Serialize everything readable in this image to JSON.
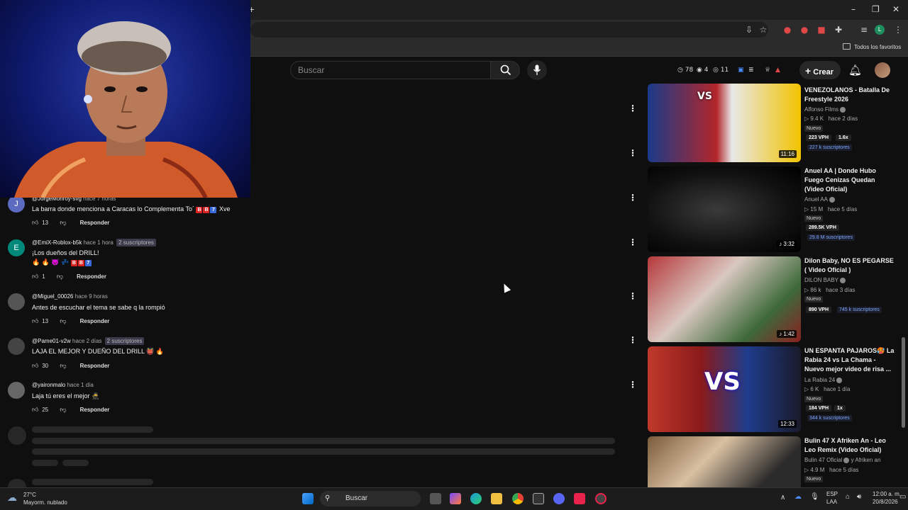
{
  "browser": {
    "new_tab_label": "+",
    "bookmarks_label": "Todos los favoritos",
    "window_controls": [
      "–",
      "❐",
      "✕"
    ]
  },
  "youtube": {
    "search_placeholder": "Buscar",
    "stats": {
      "views": "78",
      "eye": "4",
      "watch": "11"
    },
    "create_label": "Crear",
    "icons": [
      "search-icon",
      "mic-icon",
      "bell-icon",
      "plus-icon"
    ]
  },
  "comments": [
    {
      "author": "@JorgeMonroy-svg",
      "time": "hace 7 horas",
      "badge": "",
      "text": "La barra donde menciona a Caracas lo Complementa To´",
      "text_suffix": "Xve",
      "likes": "13",
      "reply": "Responder",
      "avatar_letter": "J",
      "avatar_color": "#5c6bc0"
    },
    {
      "author": "@EmiX-Roblox-b5k",
      "time": "hace 1 hora",
      "badge": "2 suscriptores",
      "text": "¡Los dueños del DRILL!",
      "text2": "🔥 🔥 😈 💤",
      "likes": "1",
      "reply": "Responder",
      "avatar_letter": "E",
      "avatar_color": "#00897b"
    },
    {
      "author": "@Miguel_00026",
      "time": "hace 9 horas",
      "badge": "",
      "text": "Antes de escuchar el tema se sabe q la rompió",
      "likes": "13",
      "reply": "Responder",
      "avatar_letter": "",
      "avatar_color": "#555"
    },
    {
      "author": "@Pame01-v2w",
      "time": "hace 2 días",
      "badge": "2 suscriptores",
      "text": "LAJA EL MEJOR Y DUEÑO DEL DRILL 👹 🔥",
      "likes": "30",
      "reply": "Responder",
      "avatar_letter": "",
      "avatar_color": "#444"
    },
    {
      "author": "@yaironmalo",
      "time": "hace 1 día",
      "badge": "",
      "text": "Laja tú eres el mejor 🥷",
      "likes": "25",
      "reply": "Responder",
      "avatar_letter": "",
      "avatar_color": "#666"
    }
  ],
  "sidebar_videos": [
    {
      "title": "VENEZOLANOS - Batalla De Freestyle 2026",
      "channel": "Alfonso Films",
      "views": "9.4 K",
      "age": "hace 2 días",
      "badge": "Nuevo",
      "vph": "223 VPH",
      "ratio": "1.6x",
      "subs": "227 k suscriptores",
      "duration": "11:16",
      "thumb_colors": [
        "#1a3a8a",
        "#b3262a",
        "#e8e8e8"
      ]
    },
    {
      "title": "Anuel AA | Donde Hubo Fuego Cenizas Quedan (Video Oficial)",
      "channel": "Anuel AA",
      "views": "15 M",
      "age": "hace 5 días",
      "badge": "Nuevo",
      "vph": "289.5K VPH",
      "ratio": "",
      "subs": "29.8 M suscriptores",
      "duration": "3:32",
      "thumb_colors": [
        "#0a0a0a",
        "#2e2e2e",
        "#9a9a9a"
      ]
    },
    {
      "title": "Dilon Baby, NO ES PEGARSE ( Video Oficial )",
      "channel": "DILON BABY",
      "views": "86 k",
      "age": "hace 3 días",
      "badge": "Nuevo",
      "vph": "890 VPH",
      "ratio": "",
      "subs": "745 k suscriptores",
      "duration": "1:42",
      "thumb_colors": [
        "#b5383a",
        "#d9c8c0",
        "#3d6a3a"
      ]
    },
    {
      "title": "UN ESPANTA PAJAROS🥵 La Rabia 24 vs La Chama - Nuevo mejor video de risa ...",
      "channel": "La Rabia 24",
      "views": "6 K",
      "age": "hace 1 día",
      "badge": "Nuevo",
      "vph": "184 VPH",
      "ratio": "1x",
      "subs": "344 k suscriptores",
      "duration": "12:33",
      "thumb_colors": [
        "#c0392b",
        "#1e3c8c",
        "#f5f5f5"
      ]
    },
    {
      "title": "Bulin 47 X Afriken An - Leo Leo Remix (Video Oficial)",
      "channel": "Bulin 47 Oficial",
      "channel_extra": "y Afriken an",
      "views": "4.9 M",
      "age": "hace 5 días",
      "badge": "Nuevo",
      "vph": "",
      "ratio": "",
      "subs": "",
      "duration": "",
      "thumb_colors": [
        "#7a5a3a",
        "#d8c0a0",
        "#2a2a2a"
      ]
    }
  ],
  "taskbar": {
    "weather_temp": "27°C",
    "weather_desc": "Mayorm. nublado",
    "search_label": "Buscar",
    "lang_top": "ESP",
    "lang_bottom": "LAA",
    "time": "12:00 a. m.",
    "date": "20/8/2026"
  }
}
